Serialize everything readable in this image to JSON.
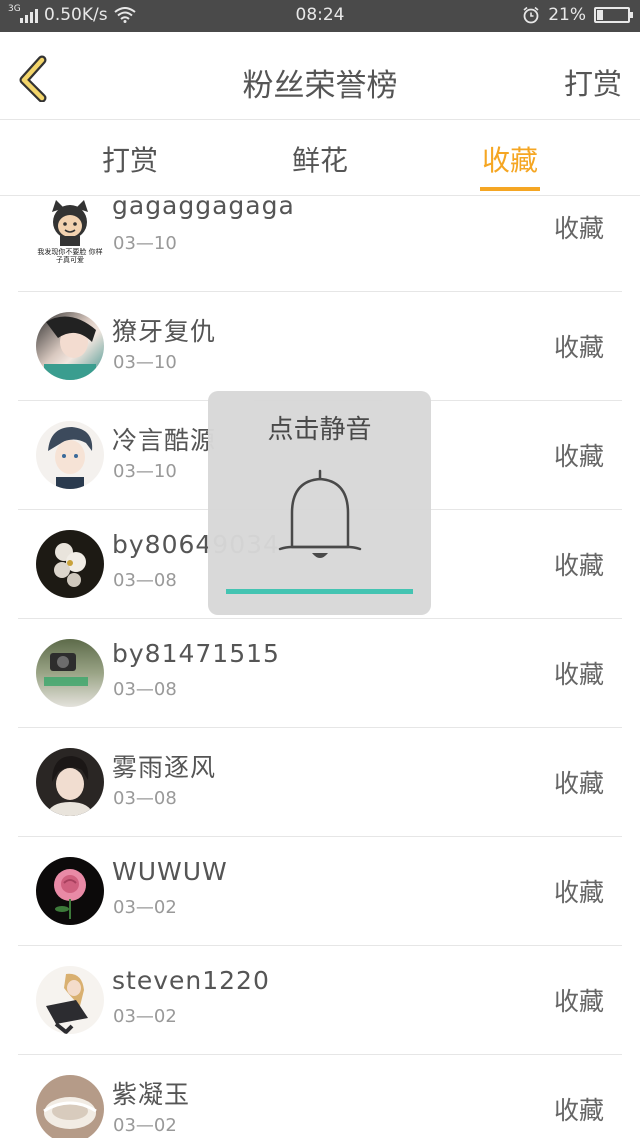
{
  "status_bar": {
    "network": "3G",
    "speed": "0.50K/s",
    "time": "08:24",
    "battery": "21%",
    "battery_level": 0.21
  },
  "header": {
    "back_icon": "chevron-left-icon",
    "title": "粉丝荣誉榜",
    "action": "打赏"
  },
  "tabs": [
    {
      "label": "打赏",
      "active": false
    },
    {
      "label": "鲜花",
      "active": false
    },
    {
      "label": "收藏",
      "active": true
    }
  ],
  "accent_color": "#f5a623",
  "list": [
    {
      "name": "gagaggagaga",
      "date": "03—10",
      "action": "收藏",
      "avatar_caption": "我发现你不要脸 你样子真可爱"
    },
    {
      "name": "獠牙复仇",
      "date": "03—10",
      "action": "收藏"
    },
    {
      "name": "冷言酷源",
      "date": "03—10",
      "action": "收藏"
    },
    {
      "name": "by80649034",
      "date": "03—08",
      "action": "收藏"
    },
    {
      "name": "by81471515",
      "date": "03—08",
      "action": "收藏"
    },
    {
      "name": "雾雨逐风",
      "date": "03—08",
      "action": "收藏"
    },
    {
      "name": "WUWUW",
      "date": "03—02",
      "action": "收藏"
    },
    {
      "name": "steven1220",
      "date": "03—02",
      "action": "收藏"
    },
    {
      "name": "紫凝玉",
      "date": "03—02",
      "action": "收藏"
    }
  ],
  "toast": {
    "title": "点击静音",
    "icon": "bell-icon",
    "bar_color": "#3ec3b0"
  }
}
